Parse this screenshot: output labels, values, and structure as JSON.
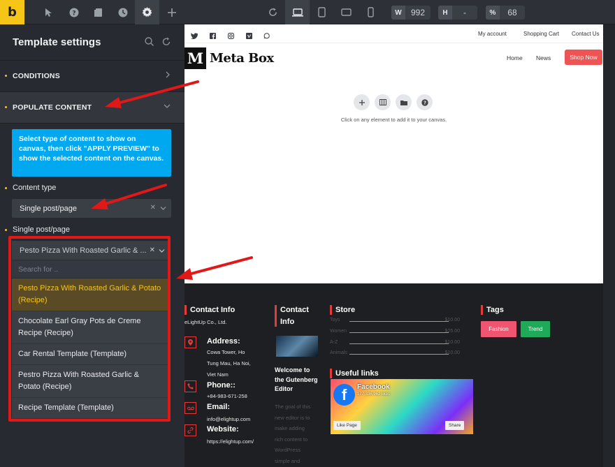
{
  "toolbar": {
    "logo": "b",
    "width_label": "W",
    "width_value": "992",
    "height_label": "H",
    "height_value": "-",
    "zoom_label": "%",
    "zoom_value": "68"
  },
  "panel": {
    "title": "Template settings",
    "sections": {
      "conditions": "CONDITIONS",
      "populate": "POPULATE CONTENT"
    },
    "info": "Select type of content to show on canvas, then click \"APPLY PREVIEW\" to show the selected content on the canvas.",
    "content_type_label": "Content type",
    "content_type_value": "Single post/page",
    "single_label": "Single post/page",
    "single_value": "Pesto Pizza With Roasted Garlic & ...",
    "search_placeholder": "Search for ..",
    "options": [
      "Pesto Pizza With Roasted Garlic & Potato (Recipe)",
      "Chocolate Earl Gray Pots de Creme Recipe (Recipe)",
      "Car Rental Template (Template)",
      "Pestro Pizza With  Roasted Garlic & Potato (Recipe)",
      "Recipe Template (Template)"
    ]
  },
  "canvas": {
    "top_links": [
      "My account",
      "Shopping Cart",
      "Contact Us"
    ],
    "brand_mark": "M",
    "brand_name": "Meta Box",
    "nav": [
      "Home",
      "News"
    ],
    "shop_button": "Shop Now",
    "hint": "Click on any element to add it to your canvas.",
    "footer": {
      "contact_title": "Contact Info",
      "company": "eLightUp Co., Ltd.",
      "address_label": "Address:",
      "address": [
        "Cowa Tower, Ho",
        "Tung Mau, Ha Noi,",
        "Viet Nam"
      ],
      "phone_label": "Phone::",
      "phone": "+84-983-671-258",
      "email_label": "Email:",
      "email": "info@elightup.com",
      "website_label": "Website:",
      "website": "https://elightup.com/",
      "contact2_title": [
        "Contact",
        "Info"
      ],
      "blog_title": [
        "Welcome to",
        "the Gutenberg",
        "Editor"
      ],
      "blog_text": [
        "The goal of this",
        "new editor is to",
        "make adding",
        "rich content to",
        "WordPress",
        "simple and"
      ],
      "store_title": "Store",
      "store_rows": [
        {
          "label": "Toys",
          "amount": "$10.00"
        },
        {
          "label": "Women",
          "amount": "$25.00"
        },
        {
          "label": "A-Z",
          "amount": "$10.00"
        },
        {
          "label": "Animals",
          "amount": "$10.00"
        }
      ],
      "useful_title": "Useful links",
      "fb_name": "Facebook",
      "fb_likes": "177,336,962 likes",
      "fb_like_btn": "Like Page",
      "fb_share_btn": "Share",
      "tags_title": "Tags",
      "tags": [
        "Fashion",
        "Trend"
      ]
    }
  },
  "colors": {
    "accent": "#f5c518",
    "info": "#00a8f0",
    "highlight": "#e01818",
    "shop": "#ef5454",
    "tag_fashion": "#ef5470",
    "tag_trend": "#1faa59"
  }
}
